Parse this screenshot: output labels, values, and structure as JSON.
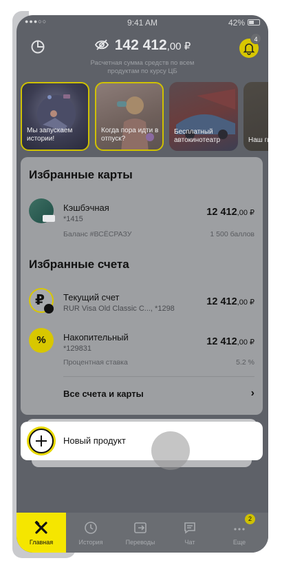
{
  "status_bar": {
    "carrier": "●●●○○",
    "time": "9:41 AM",
    "battery": "42%"
  },
  "header": {
    "balance_int": "142 412",
    "balance_frac": ",00 ₽",
    "subtitle": "Расчетная сумма средств по всем продуктам по курсу ЦБ",
    "notifications_count": "4"
  },
  "stories": [
    {
      "text": "Мы запускаем истории!"
    },
    {
      "text": "Когда пора идти в отпуск?"
    },
    {
      "text": "Бесплатный автокинотеатр"
    },
    {
      "text": "Наш гид"
    }
  ],
  "favorite_cards": {
    "title": "Избранные карты",
    "items": [
      {
        "name": "Кэшбэчная",
        "number": "*1415",
        "amount_int": "12 412",
        "amount_frac": ",00 ₽",
        "note_label": "Баланс #ВСЁСРАЗУ",
        "note_value": "1 500 баллов"
      }
    ]
  },
  "favorite_accounts": {
    "title": "Избранные счета",
    "items": [
      {
        "name": "Текущий счет",
        "number": "RUR Visa Old Classic C..., *1298",
        "amount_int": "12 412",
        "amount_frac": ",00 ₽"
      },
      {
        "name": "Накопительный",
        "number": "*129831",
        "amount_int": "12 412",
        "amount_frac": ",00 ₽",
        "note_label": "Процентная ставка",
        "note_value": "5.2 %"
      }
    ]
  },
  "all_accounts_label": "Все счета и карты",
  "new_product_label": "Новый продукт",
  "tabbar": {
    "tabs": [
      {
        "label": "Главная",
        "icon": "tools-icon"
      },
      {
        "label": "История",
        "icon": "clock-icon"
      },
      {
        "label": "Переводы",
        "icon": "transfer-icon"
      },
      {
        "label": "Чат",
        "icon": "chat-icon"
      },
      {
        "label": "Еще",
        "icon": "more-icon",
        "badge": "2"
      }
    ]
  },
  "colors": {
    "accent": "#F5E600",
    "dim_overlay": "#5E6168",
    "panel": "#9D9FA2"
  }
}
